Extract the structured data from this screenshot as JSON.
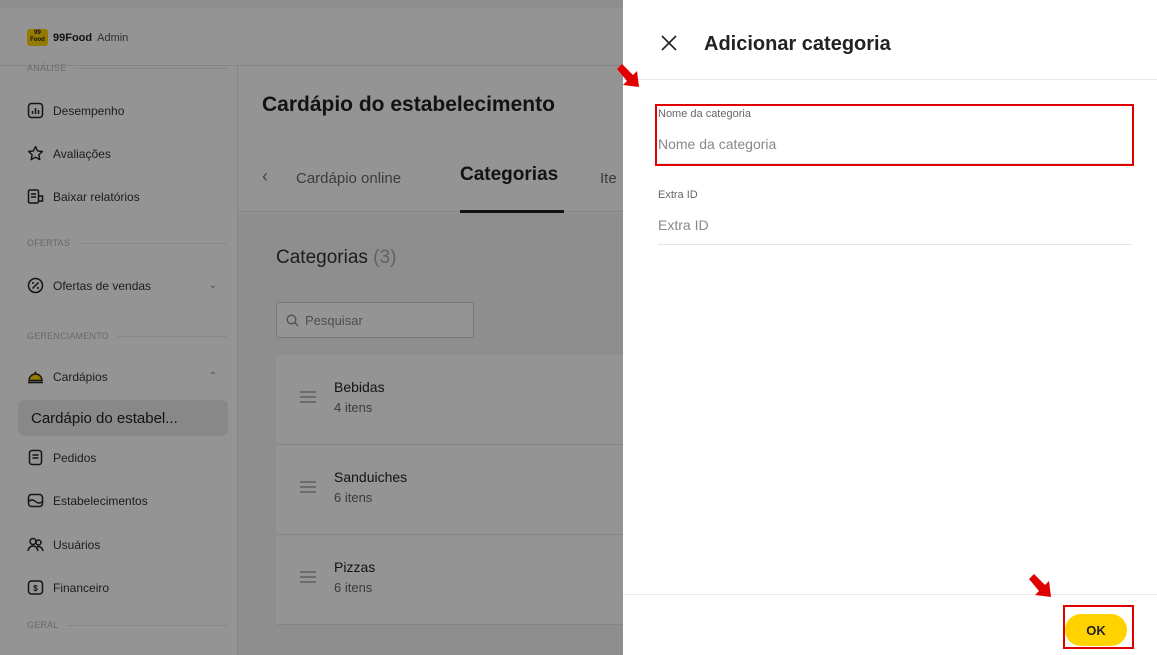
{
  "app": {
    "logo_text": "99 Food",
    "brand_name": "99Food",
    "brand_sub": "Admin"
  },
  "sidebar": {
    "sections": {
      "analise": "ANÁLISE",
      "ofertas": "OFERTAS",
      "gerenciamento": "GERENCIAMENTO",
      "geral": "GERAL"
    },
    "items": [
      {
        "label": "Desempenho",
        "icon": "chart-icon"
      },
      {
        "label": "Avaliações",
        "icon": "star-icon"
      },
      {
        "label": "Baixar relatórios",
        "icon": "report-icon"
      },
      {
        "label": "Ofertas de vendas",
        "icon": "offer-icon"
      },
      {
        "label": "Cardápios",
        "icon": "cloche-icon"
      },
      {
        "label": "Cardápio do estabel...",
        "icon": ""
      },
      {
        "label": "Pedidos",
        "icon": "orders-icon"
      },
      {
        "label": "Estabelecimentos",
        "icon": "store-icon"
      },
      {
        "label": "Usuários",
        "icon": "users-icon"
      },
      {
        "label": "Financeiro",
        "icon": "money-icon"
      }
    ],
    "accent": "#ffd200"
  },
  "main": {
    "page_title": "Cardápio do estabelecimento",
    "tabs": [
      {
        "label": "Cardápio online"
      },
      {
        "label": "Categorias"
      },
      {
        "label": "Ite"
      }
    ],
    "categories_heading": "Categorias",
    "categories_count": "(3)",
    "search_placeholder": "Pesquisar",
    "categories": [
      {
        "name": "Bebidas",
        "count": "4 itens"
      },
      {
        "name": "Sanduiches",
        "count": "6 itens"
      },
      {
        "name": "Pizzas",
        "count": "6 itens"
      }
    ]
  },
  "drawer": {
    "title": "Adicionar categoria",
    "fields": {
      "name": {
        "label": "Nome da categoria",
        "placeholder": "Nome da categoria",
        "value": ""
      },
      "extra": {
        "label": "Extra ID",
        "placeholder": "Extra ID",
        "value": ""
      }
    },
    "ok_label": "OK",
    "highlight_color": "#e10000"
  }
}
